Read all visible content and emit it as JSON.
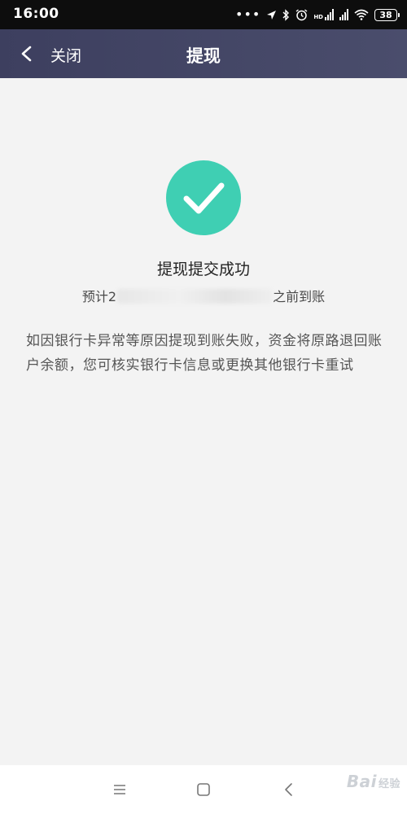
{
  "status_bar": {
    "time": "16:00",
    "dots": "•••",
    "battery": "38",
    "hd_label": "HD",
    "icons": [
      "location-icon",
      "bluetooth-icon",
      "alarm-icon",
      "signal-icon",
      "wifi-icon",
      "battery-icon"
    ]
  },
  "nav": {
    "back_label": "关闭",
    "title": "提现"
  },
  "result": {
    "icon": "checkmark-icon",
    "accent_color": "#3fcfb3",
    "title": "提现提交成功",
    "eta_prefix": "预计2",
    "eta_suffix": "之前到账",
    "notice": "如因银行卡异常等原因提现到账失败，资金将原路退回账户余额，您可核实银行卡信息或更换其他银行卡重试"
  },
  "system_nav": {
    "buttons": [
      "menu-icon",
      "home-icon",
      "back-icon"
    ]
  },
  "watermark": {
    "text": "Bai",
    "suffix": "经验"
  }
}
